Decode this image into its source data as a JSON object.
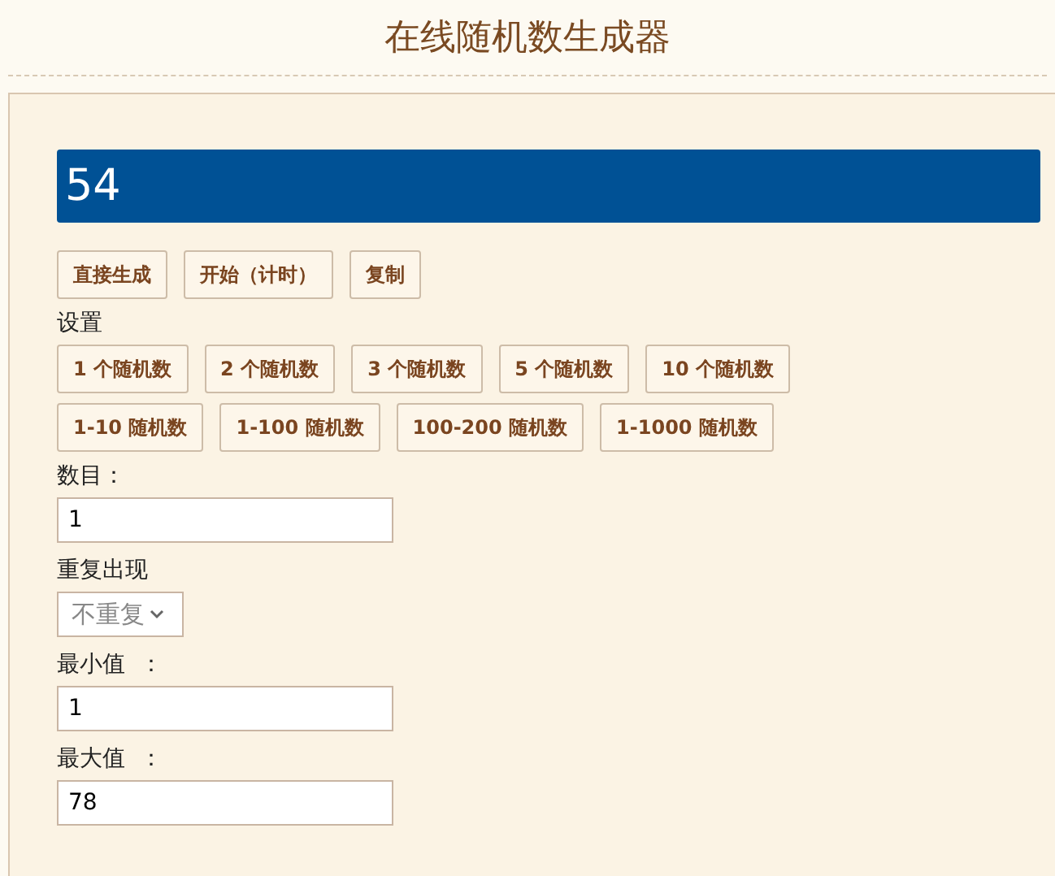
{
  "title": "在线随机数生成器",
  "result": "54",
  "actions": [
    "直接生成",
    "开始（计时）",
    "复制"
  ],
  "settings_label": "设置",
  "presets": [
    [
      "1 个随机数",
      "2 个随机数",
      "3 个随机数",
      "5 个随机数",
      "10 个随机数"
    ],
    [
      "1-10 随机数",
      "1-100 随机数",
      "100-200 随机数",
      "1-1000 随机数"
    ]
  ],
  "fields": [
    {
      "kind": "input",
      "label": "数目：",
      "value": "1"
    },
    {
      "kind": "select",
      "label": "重复出现",
      "value": "不重复"
    },
    {
      "kind": "input",
      "label": "最小值  ：",
      "value": "1"
    },
    {
      "kind": "input",
      "label": "最大值  ：",
      "value": "78"
    }
  ]
}
